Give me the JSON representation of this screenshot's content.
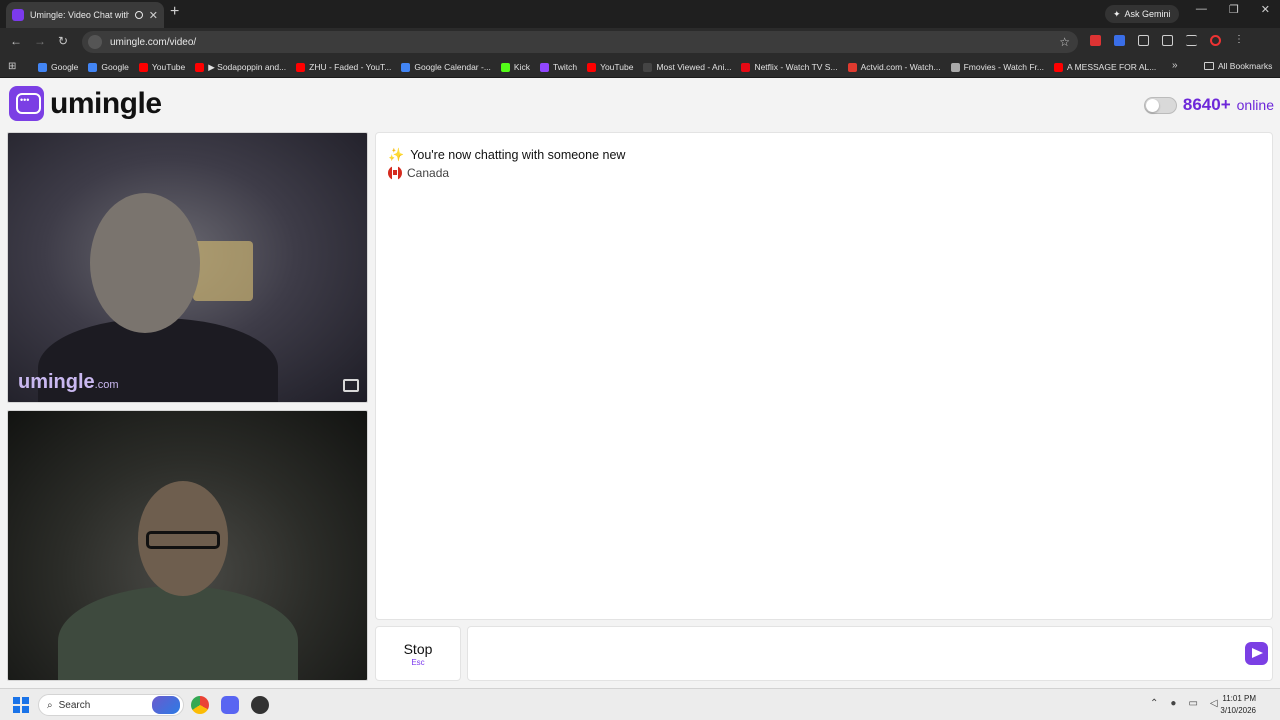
{
  "browser": {
    "tab_title": "Umingle: Video Chat with S",
    "new_tab": "+",
    "ask_gemini": "Ask Gemini",
    "url": "umingle.com/video/",
    "bookmarks": [
      {
        "label": "Google",
        "color": "#4285f4"
      },
      {
        "label": "Google",
        "color": "#4285f4"
      },
      {
        "label": "YouTube",
        "color": "#ff0000"
      },
      {
        "label": "▶ Sodapoppin and...",
        "color": "#ff0000"
      },
      {
        "label": "ZHU - Faded - YouT...",
        "color": "#ff0000"
      },
      {
        "label": "Google Calendar -...",
        "color": "#4285f4"
      },
      {
        "label": "Kick",
        "color": "#53fc18"
      },
      {
        "label": "Twitch",
        "color": "#9146ff"
      },
      {
        "label": "YouTube",
        "color": "#ff0000"
      },
      {
        "label": "Most Viewed - Ani...",
        "color": "#444444"
      },
      {
        "label": "Netflix - Watch TV S...",
        "color": "#e50914"
      },
      {
        "label": "Actvid.com - Watch...",
        "color": "#e03a2f"
      },
      {
        "label": "Fmovies - Watch Fr...",
        "color": "#aaaaaa"
      },
      {
        "label": "A MESSAGE FOR AL...",
        "color": "#ff0000"
      }
    ],
    "all_bookmarks": "All Bookmarks"
  },
  "site": {
    "logo_text": "umingle",
    "online_count": "8640+",
    "online_label": "online",
    "watermark_main": "umingle",
    "watermark_suffix": ".com",
    "system_message": "You're now chatting with someone new",
    "stranger_country": "Canada",
    "stop_label": "Stop",
    "stop_shortcut": "Esc",
    "message_placeholder": "",
    "accent_color": "#7b3fe4"
  },
  "taskbar": {
    "search_label": "Search",
    "time": "11:01 PM",
    "date": "3/10/2026"
  }
}
